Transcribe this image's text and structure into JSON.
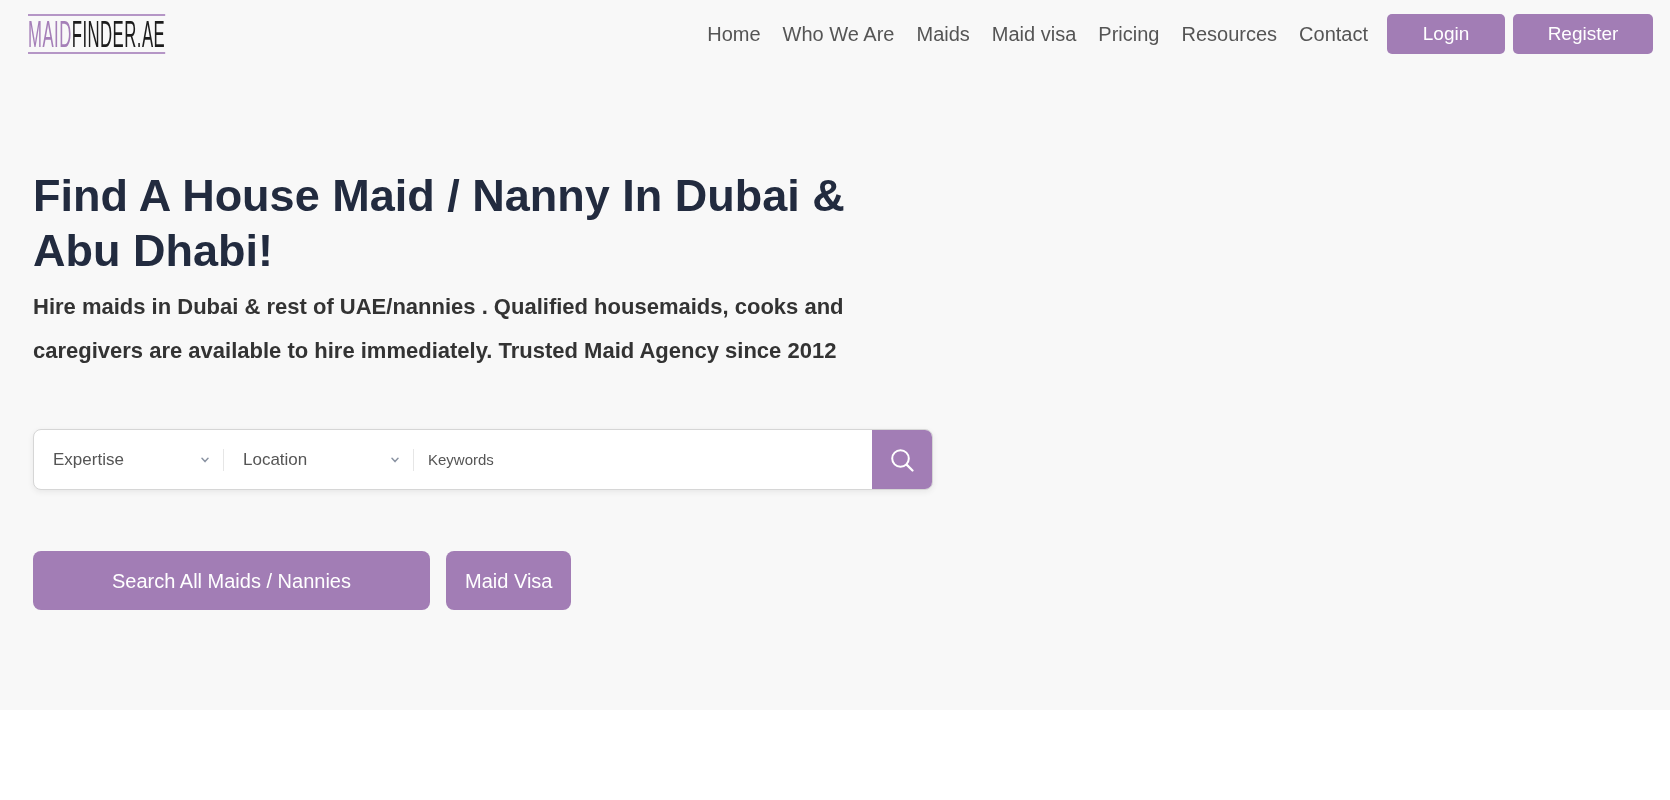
{
  "header": {
    "logo": {
      "accent": "MAID",
      "rest": "FINDER.AE"
    },
    "nav": [
      "Home",
      "Who We Are",
      "Maids",
      "Maid visa",
      "Pricing",
      "Resources",
      "Contact"
    ],
    "buttons": [
      "Login",
      "Register"
    ]
  },
  "hero": {
    "title": "Find A House Maid / Nanny In Dubai & Abu Dhabi!",
    "subtitle": "Hire maids in Dubai & rest of UAE/nannies . Qualified housemaids, cooks and caregivers are available to hire immediately. Trusted Maid Agency since 2012",
    "search": {
      "dropdowns": [
        {
          "value": "Expertise"
        },
        {
          "value": "Location"
        }
      ],
      "keywords": {
        "placeholder": "Keywords"
      }
    },
    "actions": [
      "Search All Maids / Nannies",
      "Maid Visa"
    ]
  }
}
